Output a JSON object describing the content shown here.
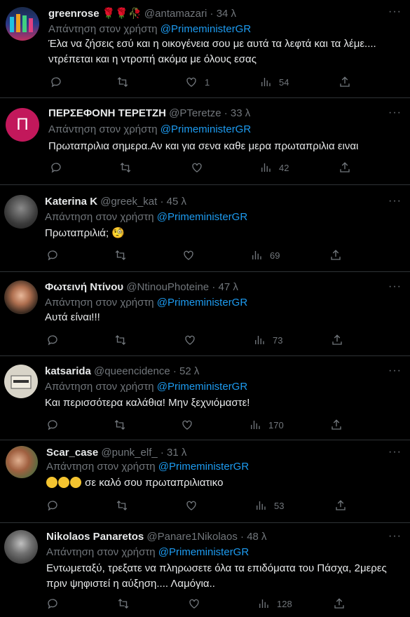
{
  "reply_prefix": "Απάντηση στον χρήστη",
  "tweets": [
    {
      "name": "greenrose",
      "name_suffix": "🌹🌹🥀",
      "handle": "@antamazari",
      "time": "· 34 λ",
      "mention": "@PrimeministerGR",
      "text_lines": [
        "Έλα να ζήσεις εσύ και η οικογένεια σου με αυτά τα λεφτά και τα λέμε....",
        "ντρέπεται και η ντροπή ακόμα με όλους εσας"
      ],
      "likes": "1",
      "views": "54"
    },
    {
      "name": "ΠΕΡΣΕΦΟΝΗ ΤΕΡΕΤΖΗ",
      "handle": "@PTeretze",
      "time": "· 33 λ",
      "avatar_letter": "Π",
      "mention": "@PrimeministerGR",
      "text_lines": [
        "Πρωταπριλια σημερα.Αν και για σενα καθε μερα πρωταπριλια ειναι"
      ],
      "likes": "",
      "views": "42"
    },
    {
      "name": "Katerina K",
      "handle": "@greek_kat",
      "time": "· 45 λ",
      "mention": "@PrimeministerGR",
      "text_lines": [
        "Πρωταπριλιά; 🧐"
      ],
      "likes": "",
      "views": "69"
    },
    {
      "name": "Φωτεινή Ντίνου",
      "handle": "@NtinouPhoteine",
      "time": "· 47 λ",
      "mention": "@PrimeministerGR",
      "text_lines": [
        "Αυτά είναι!!!"
      ],
      "likes": "",
      "views": "73"
    },
    {
      "name": "katsarida",
      "handle": "@queencidence",
      "time": "· 52 λ",
      "mention": "@PrimeministerGR",
      "text_lines": [
        "Και περισσότερα καλάθια! Μην ξεχνιόμαστε!"
      ],
      "likes": "",
      "views": "170"
    },
    {
      "name": "Scar_case",
      "handle": "@punk_elf_",
      "time": "· 31 λ",
      "mention": "@PrimeministerGR",
      "text_lines": [
        "σε καλό σου πρωταπριλιατικο"
      ],
      "likes": "",
      "views": "53"
    },
    {
      "name": "Nikolaos Panaretos",
      "handle": "@Panare1Nikolaos",
      "time": "· 48 λ",
      "mention": "@PrimeministerGR",
      "text_lines": [
        "Εντωμεταξύ, τρεξατε να πληρωσετε όλα τα επιδόματα του Πάσχα, 2μερες",
        "πριν ψηφιστεί η αύξηση.... Λαμόγια.."
      ],
      "likes": "",
      "views": "128"
    }
  ],
  "colors": {
    "background": "#000000",
    "text": "#e7e9ea",
    "muted": "#71767b",
    "link": "#1d9bf0",
    "divider": "#2f3336"
  },
  "icons": [
    "reply-icon",
    "retweet-icon",
    "like-icon",
    "views-icon",
    "share-icon",
    "more-icon"
  ]
}
